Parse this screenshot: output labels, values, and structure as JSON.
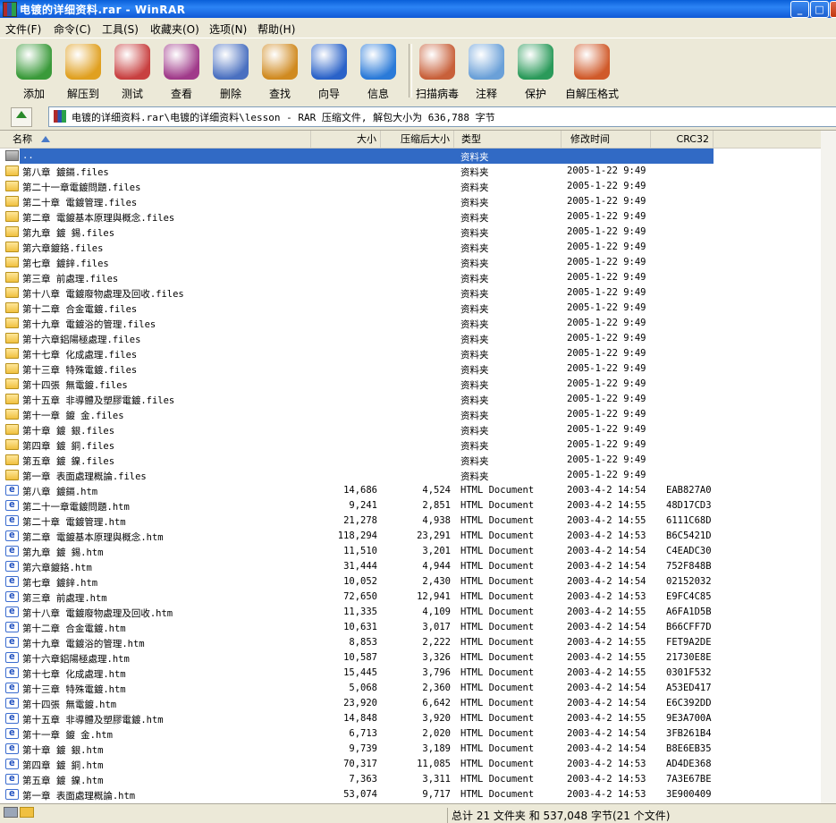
{
  "window": {
    "title": "电镀的详细资料.rar - WinRAR"
  },
  "menu": [
    "文件(F)",
    "命令(C)",
    "工具(S)",
    "收藏夹(O)",
    "选项(N)",
    "帮助(H)"
  ],
  "toolbar": [
    {
      "label": "添加",
      "icon": "add-icon",
      "color": "#3a9a3a"
    },
    {
      "label": "解压到",
      "icon": "extract-to-icon",
      "color": "#e0a020"
    },
    {
      "label": "测试",
      "icon": "test-icon",
      "color": "#c84040"
    },
    {
      "label": "查看",
      "icon": "view-icon",
      "color": "#a03a8a"
    },
    {
      "label": "删除",
      "icon": "delete-icon",
      "color": "#4a70c0"
    },
    {
      "label": "查找",
      "icon": "find-icon",
      "color": "#d08a20"
    },
    {
      "label": "向导",
      "icon": "wizard-icon",
      "color": "#2a62c8"
    },
    {
      "label": "信息",
      "icon": "info-icon",
      "color": "#2a7ad8"
    },
    {
      "label": "扫描病毒",
      "icon": "virus-scan-icon",
      "color": "#c8603a"
    },
    {
      "label": "注释",
      "icon": "comment-icon",
      "color": "#6aa0d8"
    },
    {
      "label": "保护",
      "icon": "protect-icon",
      "color": "#2a9a5a"
    },
    {
      "label": "自解压格式",
      "icon": "sfx-icon",
      "color": "#d05a2a"
    }
  ],
  "address": {
    "text": "电镀的详细资料.rar\\电镀的详细资料\\lesson - RAR 压缩文件, 解包大小为 636,788 字节"
  },
  "columns": {
    "name": "名称",
    "size": "大小",
    "packed": "压缩后大小",
    "type": "类型",
    "modified": "修改时间",
    "crc": "CRC32"
  },
  "rows": [
    {
      "icon": "up",
      "name": "..",
      "size": "",
      "packed": "",
      "type": "资料夹",
      "modified": "",
      "crc": "",
      "selected": true
    },
    {
      "icon": "folder",
      "name": "第八章 鍍鎘.files",
      "size": "",
      "packed": "",
      "type": "资料夹",
      "modified": "2005-1-22 9:49",
      "crc": ""
    },
    {
      "icon": "folder",
      "name": "第二十一章電鍍問題.files",
      "size": "",
      "packed": "",
      "type": "资料夹",
      "modified": "2005-1-22 9:49",
      "crc": ""
    },
    {
      "icon": "folder",
      "name": "第二十章 電鍍管理.files",
      "size": "",
      "packed": "",
      "type": "资料夹",
      "modified": "2005-1-22 9:49",
      "crc": ""
    },
    {
      "icon": "folder",
      "name": "第二章 電鍍基本原理與概念.files",
      "size": "",
      "packed": "",
      "type": "资料夹",
      "modified": "2005-1-22 9:49",
      "crc": ""
    },
    {
      "icon": "folder",
      "name": "第九章 鍍 錫.files",
      "size": "",
      "packed": "",
      "type": "资料夹",
      "modified": "2005-1-22 9:49",
      "crc": ""
    },
    {
      "icon": "folder",
      "name": "第六章鍍鉻.files",
      "size": "",
      "packed": "",
      "type": "资料夹",
      "modified": "2005-1-22 9:49",
      "crc": ""
    },
    {
      "icon": "folder",
      "name": "第七章 鍍鋅.files",
      "size": "",
      "packed": "",
      "type": "资料夹",
      "modified": "2005-1-22 9:49",
      "crc": ""
    },
    {
      "icon": "folder",
      "name": "第三章 前處理.files",
      "size": "",
      "packed": "",
      "type": "资料夹",
      "modified": "2005-1-22 9:49",
      "crc": ""
    },
    {
      "icon": "folder",
      "name": "第十八章 電鍍廢物處理及回收.files",
      "size": "",
      "packed": "",
      "type": "资料夹",
      "modified": "2005-1-22 9:49",
      "crc": ""
    },
    {
      "icon": "folder",
      "name": "第十二章 合金電鍍.files",
      "size": "",
      "packed": "",
      "type": "资料夹",
      "modified": "2005-1-22 9:49",
      "crc": ""
    },
    {
      "icon": "folder",
      "name": "第十九章 電鍍浴的管理.files",
      "size": "",
      "packed": "",
      "type": "资料夹",
      "modified": "2005-1-22 9:49",
      "crc": ""
    },
    {
      "icon": "folder",
      "name": "第十六章鋁陽極處理.files",
      "size": "",
      "packed": "",
      "type": "资料夹",
      "modified": "2005-1-22 9:49",
      "crc": ""
    },
    {
      "icon": "folder",
      "name": "第十七章 化成處理.files",
      "size": "",
      "packed": "",
      "type": "资料夹",
      "modified": "2005-1-22 9:49",
      "crc": ""
    },
    {
      "icon": "folder",
      "name": "第十三章 特殊電鍍.files",
      "size": "",
      "packed": "",
      "type": "资料夹",
      "modified": "2005-1-22 9:49",
      "crc": ""
    },
    {
      "icon": "folder",
      "name": "第十四張 無電鍍.files",
      "size": "",
      "packed": "",
      "type": "资料夹",
      "modified": "2005-1-22 9:49",
      "crc": ""
    },
    {
      "icon": "folder",
      "name": "第十五章 非導體及塑膠電鍍.files",
      "size": "",
      "packed": "",
      "type": "资料夹",
      "modified": "2005-1-22 9:49",
      "crc": ""
    },
    {
      "icon": "folder",
      "name": "第十一章 鍍 金.files",
      "size": "",
      "packed": "",
      "type": "资料夹",
      "modified": "2005-1-22 9:49",
      "crc": ""
    },
    {
      "icon": "folder",
      "name": "第十章 鍍 銀.files",
      "size": "",
      "packed": "",
      "type": "资料夹",
      "modified": "2005-1-22 9:49",
      "crc": ""
    },
    {
      "icon": "folder",
      "name": "第四章 鍍 銅.files",
      "size": "",
      "packed": "",
      "type": "资料夹",
      "modified": "2005-1-22 9:49",
      "crc": ""
    },
    {
      "icon": "folder",
      "name": "第五章 鍍 鎳.files",
      "size": "",
      "packed": "",
      "type": "资料夹",
      "modified": "2005-1-22 9:49",
      "crc": ""
    },
    {
      "icon": "folder",
      "name": "第一章 表面處理概論.files",
      "size": "",
      "packed": "",
      "type": "资料夹",
      "modified": "2005-1-22 9:49",
      "crc": ""
    },
    {
      "icon": "html",
      "name": "第八章 鍍鎘.htm",
      "size": "14,686",
      "packed": "4,524",
      "type": "HTML Document",
      "modified": "2003-4-2 14:54",
      "crc": "EAB827A0"
    },
    {
      "icon": "html",
      "name": "第二十一章電鍍問題.htm",
      "size": "9,241",
      "packed": "2,851",
      "type": "HTML Document",
      "modified": "2003-4-2 14:55",
      "crc": "48D17CD3"
    },
    {
      "icon": "html",
      "name": "第二十章 電鍍管理.htm",
      "size": "21,278",
      "packed": "4,938",
      "type": "HTML Document",
      "modified": "2003-4-2 14:55",
      "crc": "6111C68D"
    },
    {
      "icon": "html",
      "name": "第二章 電鍍基本原理與概念.htm",
      "size": "118,294",
      "packed": "23,291",
      "type": "HTML Document",
      "modified": "2003-4-2 14:53",
      "crc": "B6C5421D"
    },
    {
      "icon": "html",
      "name": "第九章 鍍 錫.htm",
      "size": "11,510",
      "packed": "3,201",
      "type": "HTML Document",
      "modified": "2003-4-2 14:54",
      "crc": "C4EADC30"
    },
    {
      "icon": "html",
      "name": "第六章鍍鉻.htm",
      "size": "31,444",
      "packed": "4,944",
      "type": "HTML Document",
      "modified": "2003-4-2 14:54",
      "crc": "752F848B"
    },
    {
      "icon": "html",
      "name": "第七章 鍍鋅.htm",
      "size": "10,052",
      "packed": "2,430",
      "type": "HTML Document",
      "modified": "2003-4-2 14:54",
      "crc": "02152032"
    },
    {
      "icon": "html",
      "name": "第三章 前處理.htm",
      "size": "72,650",
      "packed": "12,941",
      "type": "HTML Document",
      "modified": "2003-4-2 14:53",
      "crc": "E9FC4C85"
    },
    {
      "icon": "html",
      "name": "第十八章 電鍍廢物處理及回收.htm",
      "size": "11,335",
      "packed": "4,109",
      "type": "HTML Document",
      "modified": "2003-4-2 14:55",
      "crc": "A6FA1D5B"
    },
    {
      "icon": "html",
      "name": "第十二章 合金電鍍.htm",
      "size": "10,631",
      "packed": "3,017",
      "type": "HTML Document",
      "modified": "2003-4-2 14:54",
      "crc": "B66CFF7D"
    },
    {
      "icon": "html",
      "name": "第十九章 電鍍浴的管理.htm",
      "size": "8,853",
      "packed": "2,222",
      "type": "HTML Document",
      "modified": "2003-4-2 14:55",
      "crc": "FET9A2DE"
    },
    {
      "icon": "html",
      "name": "第十六章鋁陽極處理.htm",
      "size": "10,587",
      "packed": "3,326",
      "type": "HTML Document",
      "modified": "2003-4-2 14:55",
      "crc": "21730E8E"
    },
    {
      "icon": "html",
      "name": "第十七章 化成處理.htm",
      "size": "15,445",
      "packed": "3,796",
      "type": "HTML Document",
      "modified": "2003-4-2 14:55",
      "crc": "0301F532"
    },
    {
      "icon": "html",
      "name": "第十三章 特殊電鍍.htm",
      "size": "5,068",
      "packed": "2,360",
      "type": "HTML Document",
      "modified": "2003-4-2 14:54",
      "crc": "A53ED417"
    },
    {
      "icon": "html",
      "name": "第十四張 無電鍍.htm",
      "size": "23,920",
      "packed": "6,642",
      "type": "HTML Document",
      "modified": "2003-4-2 14:54",
      "crc": "E6C392DD"
    },
    {
      "icon": "html",
      "name": "第十五章 非導體及塑膠電鍍.htm",
      "size": "14,848",
      "packed": "3,920",
      "type": "HTML Document",
      "modified": "2003-4-2 14:55",
      "crc": "9E3A700A"
    },
    {
      "icon": "html",
      "name": "第十一章 鍍 金.htm",
      "size": "6,713",
      "packed": "2,020",
      "type": "HTML Document",
      "modified": "2003-4-2 14:54",
      "crc": "3FB261B4"
    },
    {
      "icon": "html",
      "name": "第十章 鍍 銀.htm",
      "size": "9,739",
      "packed": "3,189",
      "type": "HTML Document",
      "modified": "2003-4-2 14:54",
      "crc": "B8E6EB35"
    },
    {
      "icon": "html",
      "name": "第四章 鍍 銅.htm",
      "size": "70,317",
      "packed": "11,085",
      "type": "HTML Document",
      "modified": "2003-4-2 14:53",
      "crc": "AD4DE368"
    },
    {
      "icon": "html",
      "name": "第五章 鍍 鎳.htm",
      "size": "7,363",
      "packed": "3,311",
      "type": "HTML Document",
      "modified": "2003-4-2 14:53",
      "crc": "7A3E67BE"
    },
    {
      "icon": "html",
      "name": "第一章 表面處理概論.htm",
      "size": "53,074",
      "packed": "9,717",
      "type": "HTML Document",
      "modified": "2003-4-2 14:53",
      "crc": "3E900409"
    }
  ],
  "status": {
    "text": "总计 21 文件夹 和 537,048 字节(21 个文件)"
  }
}
